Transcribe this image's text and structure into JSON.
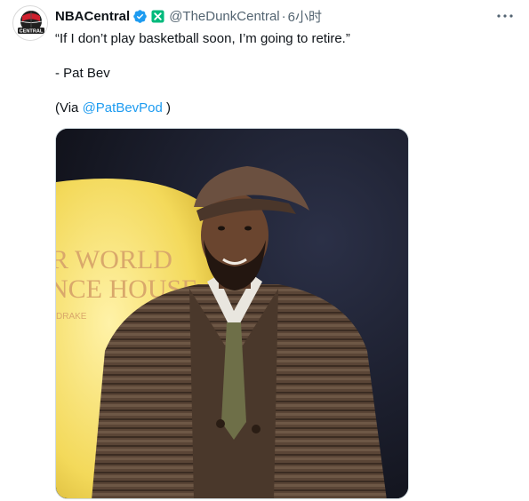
{
  "tweet": {
    "author_name": "NBACentral",
    "handle": "@TheDunkCentral",
    "separator": "·",
    "timestamp": "6小时",
    "more_icon": "ellipsis-icon",
    "text_line1": "“If I don’t play basketball soon, I’m going to retire.”",
    "text_line2": "- Pat Bev",
    "via_prefix": "(Via ",
    "via_mention": "@PatBevPod",
    "via_suffix": " )",
    "verified_icon": "verified-badge-icon",
    "affiliate_icon": "affiliate-badge-icon"
  },
  "avatar": {
    "logo_text": "CENTRAL"
  },
  "media": {
    "sign_line1": "R WORLD",
    "sign_line2": "NCE HOUSE",
    "sign_line3": "DRAKE"
  },
  "colors": {
    "link": "#1d9bf0",
    "verified": "#1d9bf0",
    "affiliate": "#00ba7c",
    "muted": "#536471"
  }
}
